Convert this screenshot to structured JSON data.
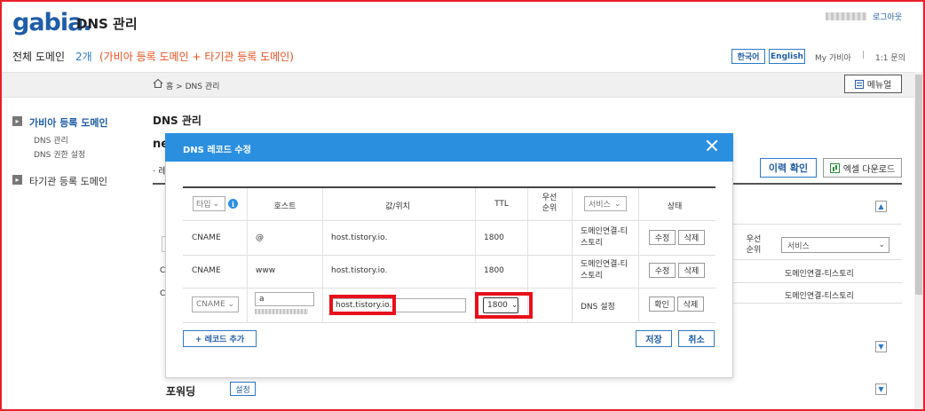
{
  "header": {
    "logo_text": "gabia",
    "logo_dot": ".",
    "app_title": "DNS 관리",
    "logout": "로그아웃",
    "domain_all": "전체 도메인",
    "domain_count": "2개",
    "domain_detail": "(가비아 등록 도메인 + 타기관 등록 도메인)",
    "lang_ko": "한국어",
    "lang_en": "English",
    "my_gabia": "My 가비아",
    "separator": "|",
    "inquiry": "1:1 문의"
  },
  "breadcrumb": {
    "home": "홈",
    "arrow": ">",
    "current": "DNS 관리"
  },
  "manual_button": "메뉴얼",
  "sidebar": {
    "items": [
      {
        "label": "가비아 등록 도메인",
        "children": [
          "DNS 관리",
          "DNS 권한 설정"
        ]
      },
      {
        "label": "타기관 등록 도메인"
      }
    ]
  },
  "page": {
    "title": "DNS 관리",
    "partial_heading": "ne",
    "partial_sub": "· 레",
    "history_button": "이력 확인",
    "excel_button": "엑셀 다운로드",
    "bg_priority": "우선\n순위",
    "bg_service_select": "서비스",
    "bg_service_1": "도메인연결-티스토리",
    "bg_service_2": "도메인연결-티스토리",
    "bg_c1": "C",
    "bg_c2": "C",
    "forward_label": "포워딩",
    "forward_button": "설정"
  },
  "modal": {
    "title": "DNS 레코드 수정",
    "headers": {
      "type": "타입",
      "host": "호스트",
      "value": "값/위치",
      "ttl": "TTL",
      "priority": "우선\n순위",
      "service": "서비스",
      "status": "상태"
    },
    "rows": [
      {
        "type": "CNAME",
        "host": "@",
        "value": "host.tistory.io.",
        "ttl": "1800",
        "service": "도메인연결-티\n스토리",
        "btn1": "수정",
        "btn2": "삭제"
      },
      {
        "type": "CNAME",
        "host": "www",
        "value": "host.tistory.io.",
        "ttl": "1800",
        "service": "도메인연결-티\n스토리",
        "btn1": "수정",
        "btn2": "삭제"
      }
    ],
    "edit_row": {
      "type": "CNAME",
      "host": "a",
      "value": "host.tistory.io.",
      "ttl": "1800",
      "service": "DNS 설정",
      "btn1": "확인",
      "btn2": "삭제"
    },
    "add_button": "+ 레코드 추가",
    "save_button": "저장",
    "cancel_button": "취소"
  },
  "colors": {
    "brand": "#1f5da8",
    "modal_header": "#2b8fe0",
    "accent_orange": "#e8501e",
    "highlight_red": "#e8101a"
  }
}
